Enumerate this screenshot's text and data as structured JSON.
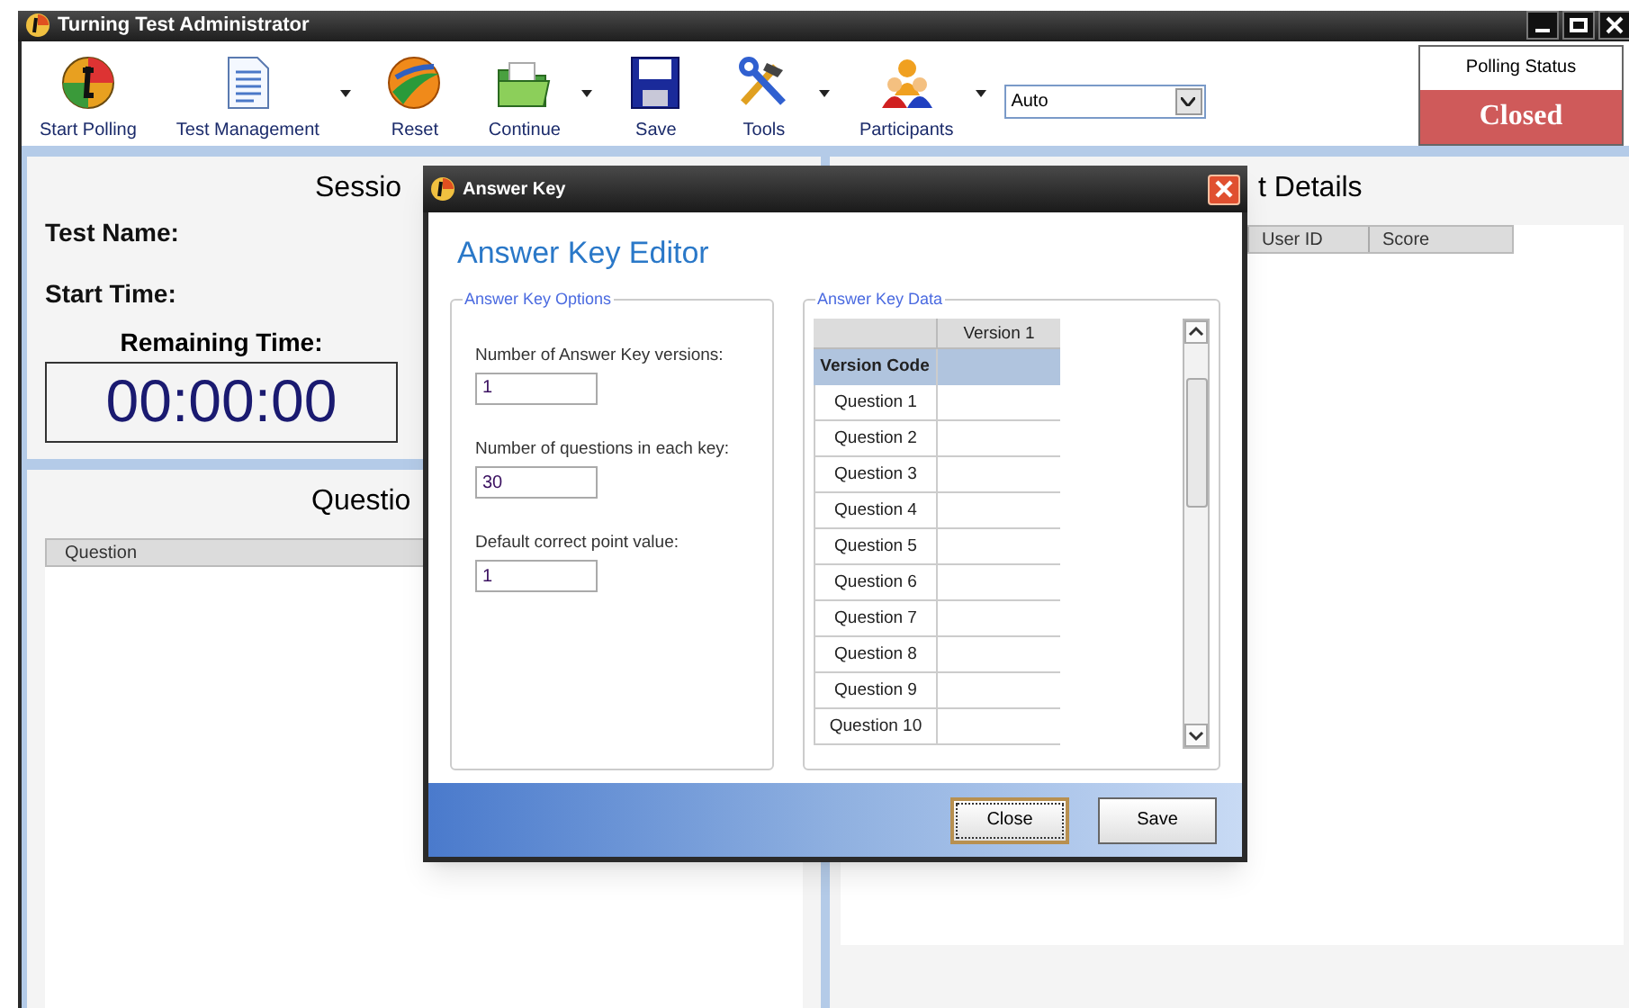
{
  "window": {
    "title": "Turning Test Administrator"
  },
  "toolbar": [
    {
      "label": "Start Polling",
      "kind": "polling",
      "has_menu": false
    },
    {
      "label": "Test Management",
      "kind": "document",
      "has_menu": true
    },
    {
      "label": "Reset",
      "kind": "reset",
      "has_menu": false
    },
    {
      "label": "Continue",
      "kind": "folder",
      "has_menu": true
    },
    {
      "label": "Save",
      "kind": "save",
      "has_menu": false
    },
    {
      "label": "Tools",
      "kind": "tools",
      "has_menu": true
    },
    {
      "label": "Participants",
      "kind": "people",
      "has_menu": true
    }
  ],
  "mode_select": {
    "value": "Auto"
  },
  "polling_status": {
    "label": "Polling Status",
    "value": "Closed"
  },
  "session_panel": {
    "heading": "Sessio",
    "fields": [
      "Test Name:",
      "Start Time:"
    ],
    "remaining_label": "Remaining Time:",
    "timer": "00:00:00"
  },
  "question_panel": {
    "heading": "Questio",
    "columns": [
      "Question"
    ]
  },
  "details_panel": {
    "heading": "t Details",
    "columns": [
      "User ID",
      "Score"
    ]
  },
  "dialog": {
    "title": "Answer Key",
    "heading": "Answer Key Editor",
    "options": {
      "legend": "Answer Key Options",
      "fields": [
        {
          "label": "Number of Answer Key versions:",
          "value": "1"
        },
        {
          "label": "Number of questions in each key:",
          "value": "30"
        },
        {
          "label": "Default correct point value:",
          "value": "1"
        }
      ]
    },
    "data": {
      "legend": "Answer Key Data",
      "columns": [
        "Version 1"
      ],
      "code_label": "Version Code",
      "rows": [
        "Question 1",
        "Question 2",
        "Question 3",
        "Question 4",
        "Question 5",
        "Question 6",
        "Question 7",
        "Question 8",
        "Question 9",
        "Question 10"
      ]
    },
    "buttons": [
      {
        "label": "Close",
        "focused": true
      },
      {
        "label": "Save",
        "focused": false
      }
    ]
  }
}
